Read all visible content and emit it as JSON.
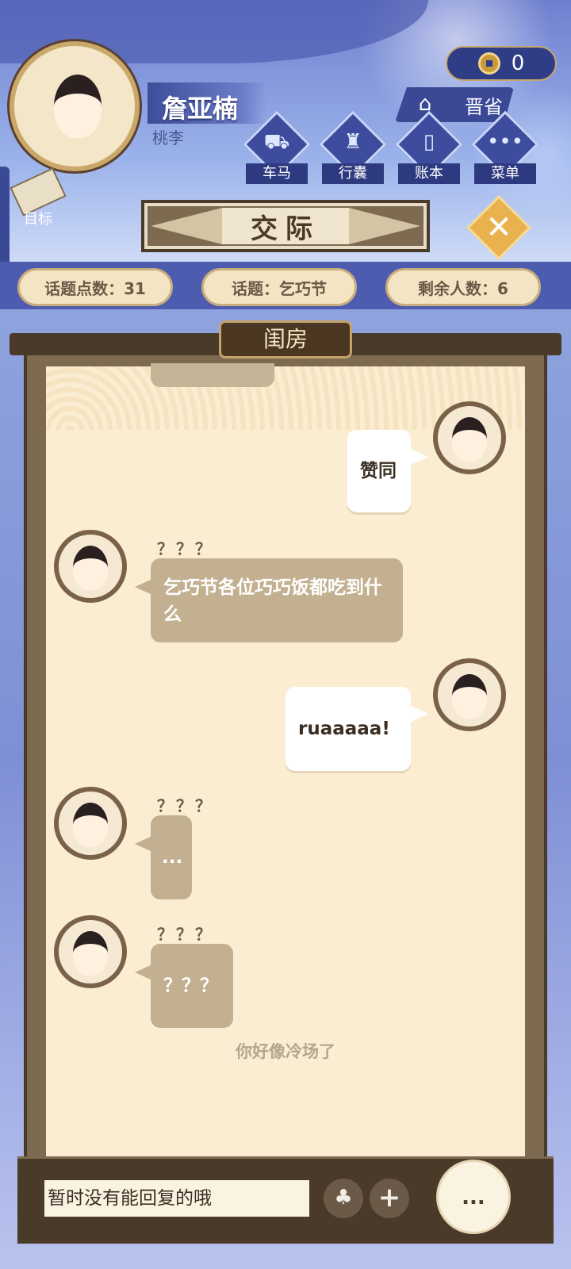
{
  "player": {
    "name": "詹亚楠",
    "subtitle": "桃李"
  },
  "currency": {
    "value": "0"
  },
  "jinsheng": {
    "label": "晋省"
  },
  "menu": [
    {
      "label": "车马",
      "icon": "carriage-icon"
    },
    {
      "label": "行囊",
      "icon": "bag-icon"
    },
    {
      "label": "账本",
      "icon": "ledger-icon"
    },
    {
      "label": "菜单",
      "icon": "more-icon"
    }
  ],
  "goal": {
    "label": "目标"
  },
  "page": {
    "title": "交际"
  },
  "stats": {
    "topic_points": "话题点数：31",
    "topic": "话题：乞巧节",
    "remaining": "剩余人数：6"
  },
  "room": {
    "name": "闺房"
  },
  "messages": [
    {
      "side": "right",
      "text": "赞同"
    },
    {
      "side": "left",
      "sender": "？？？",
      "text": "乞巧节各位巧巧饭都吃到什么"
    },
    {
      "side": "right",
      "text": "ruaaaaa!"
    },
    {
      "side": "left",
      "sender": "？？？",
      "text": "..."
    },
    {
      "side": "left",
      "sender": "？？？",
      "text": "？？？"
    }
  ],
  "hint": "你好像冷场了",
  "input": {
    "text": "暂时没有能回复的哦"
  },
  "actions": {
    "more": "..."
  },
  "colors": {
    "paper": "#fbedd2",
    "bubble_left": "#c3b090",
    "frame": "#7d6a51",
    "accent": "#e9b24f"
  }
}
